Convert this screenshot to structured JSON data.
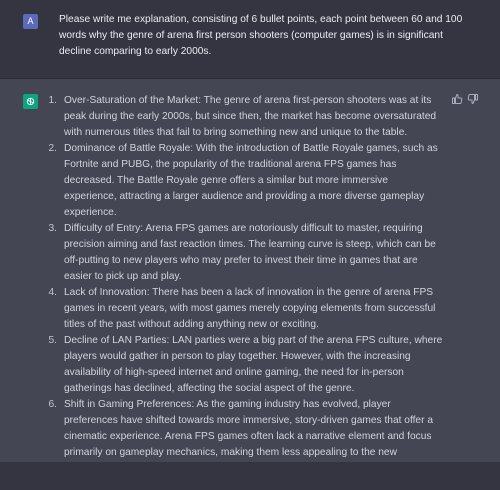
{
  "user": {
    "avatar_letter": "A",
    "message": "Please write me explanation, consisting of 6 bullet points, each point between 60 and 100 words why the genre of arena first person shooters (computer games) is in significant decline comparing to early 2000s."
  },
  "assistant": {
    "points": [
      {
        "num": "1.",
        "text": "Over-Saturation of the Market: The genre of arena first-person shooters was at its peak during the early 2000s, but since then, the market has become oversaturated with numerous titles that fail to bring something new and unique to the table."
      },
      {
        "num": "2.",
        "text": "Dominance of Battle Royale: With the introduction of Battle Royale games, such as Fortnite and PUBG, the popularity of the traditional arena FPS games has decreased. The Battle Royale genre offers a similar but more immersive experience, attracting a larger audience and providing a more diverse gameplay experience."
      },
      {
        "num": "3.",
        "text": "Difficulty of Entry: Arena FPS games are notoriously difficult to master, requiring precision aiming and fast reaction times. The learning curve is steep, which can be off-putting to new players who may prefer to invest their time in games that are easier to pick up and play."
      },
      {
        "num": "4.",
        "text": "Lack of Innovation: There has been a lack of innovation in the genre of arena FPS games in recent years, with most games merely copying elements from successful titles of the past without adding anything new or exciting."
      },
      {
        "num": "5.",
        "text": "Decline of LAN Parties: LAN parties were a big part of the arena FPS culture, where players would gather in person to play together. However, with the increasing availability of high-speed internet and online gaming, the need for in-person gatherings has declined, affecting the social aspect of the genre."
      },
      {
        "num": "6.",
        "text": "Shift in Gaming Preferences: As the gaming industry has evolved, player preferences have shifted towards more immersive, story-driven games that offer a cinematic experience. Arena FPS games often lack a narrative element and focus primarily on gameplay mechanics, making them less appealing to the new generation of gamers."
      }
    ]
  },
  "icons": {
    "user_avatar": "letter-avatar",
    "assistant_avatar": "openai-logo-icon",
    "like": "thumbs-up-icon",
    "dislike": "thumbs-down-icon"
  },
  "colors": {
    "background": "#343541",
    "assistant_background": "#444654",
    "user_avatar": "#5b6ab9",
    "assistant_avatar": "#10a37f"
  }
}
